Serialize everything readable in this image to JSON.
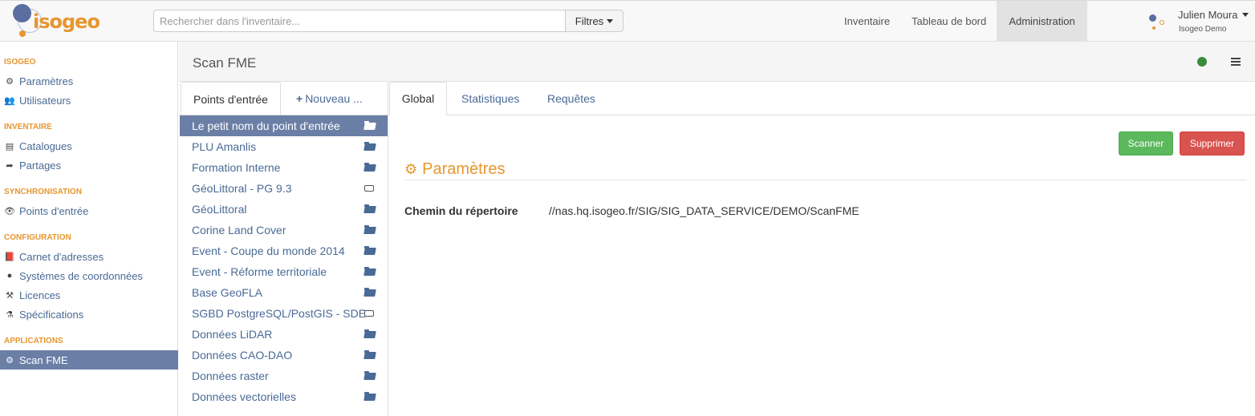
{
  "brand": {
    "logo_text": "isogeo"
  },
  "search": {
    "placeholder": "Rechercher dans l'inventaire..."
  },
  "filters_label": "Filtres",
  "topnav": [
    {
      "label": "Inventaire",
      "active": false
    },
    {
      "label": "Tableau de bord",
      "active": false
    },
    {
      "label": "Administration",
      "active": true
    }
  ],
  "user": {
    "name": "Julien Moura",
    "org": "Isogeo Demo"
  },
  "sidebar": {
    "sections": [
      {
        "title": "ISOGEO",
        "items": [
          {
            "label": "Paramètres",
            "icon": "gears-icon"
          },
          {
            "label": "Utilisateurs",
            "icon": "users-icon"
          }
        ]
      },
      {
        "title": "INVENTAIRE",
        "items": [
          {
            "label": "Catalogues",
            "icon": "list-icon"
          },
          {
            "label": "Partages",
            "icon": "share-icon"
          }
        ]
      },
      {
        "title": "SYNCHRONISATION",
        "items": [
          {
            "label": "Points d'entrée",
            "icon": "eye-icon"
          }
        ]
      },
      {
        "title": "CONFIGURATION",
        "items": [
          {
            "label": "Carnet d'adresses",
            "icon": "book-icon"
          },
          {
            "label": "Systèmes de coordonnées",
            "icon": "globe-icon"
          },
          {
            "label": "Licences",
            "icon": "gavel-icon"
          },
          {
            "label": "Spécifications",
            "icon": "flask-icon"
          }
        ]
      },
      {
        "title": "APPLICATIONS",
        "items": [
          {
            "label": "Scan FME",
            "icon": "gear-icon",
            "active": true
          }
        ]
      }
    ]
  },
  "page": {
    "title": "Scan FME"
  },
  "entry_tabs": {
    "active": "Points d'entrée",
    "new": "Nouveau ..."
  },
  "entries": [
    {
      "label": "Le petit nom du point d'entrée",
      "icon": "folder-open-icon",
      "active": true
    },
    {
      "label": "PLU Amanlis",
      "icon": "folder-open-icon"
    },
    {
      "label": "Formation Interne",
      "icon": "folder-open-icon"
    },
    {
      "label": "GéoLittoral - PG 9.3",
      "icon": "database-icon"
    },
    {
      "label": "GéoLittoral",
      "icon": "folder-open-icon"
    },
    {
      "label": "Corine Land Cover",
      "icon": "folder-open-icon"
    },
    {
      "label": "Event - Coupe du monde 2014",
      "icon": "folder-open-icon"
    },
    {
      "label": "Event - Réforme territoriale",
      "icon": "folder-open-icon"
    },
    {
      "label": "Base GeoFLA",
      "icon": "folder-open-icon"
    },
    {
      "label": "SGBD PostgreSQL/PostGIS - SDE",
      "icon": "database-icon"
    },
    {
      "label": "Données LiDAR",
      "icon": "folder-open-icon"
    },
    {
      "label": "Données CAO-DAO",
      "icon": "folder-open-icon"
    },
    {
      "label": "Données raster",
      "icon": "folder-open-icon"
    },
    {
      "label": "Données vectorielles",
      "icon": "folder-open-icon"
    }
  ],
  "detail_tabs": [
    {
      "label": "Global",
      "active": true
    },
    {
      "label": "Statistiques"
    },
    {
      "label": "Requêtes"
    }
  ],
  "actions": {
    "scan": "Scanner",
    "delete": "Supprimer"
  },
  "section": {
    "title": "Paramètres"
  },
  "fields": [
    {
      "label": "Chemin du répertoire",
      "value": "//nas.hq.isogeo.fr/SIG/SIG_DATA_SERVICE/DEMO/ScanFME"
    }
  ],
  "colors": {
    "accent": "#e7962d",
    "link": "#4a6a96",
    "active_bg": "#6b7fa6",
    "status_ok": "#3a8a3e",
    "success": "#5cb85c",
    "danger": "#d9534f"
  }
}
